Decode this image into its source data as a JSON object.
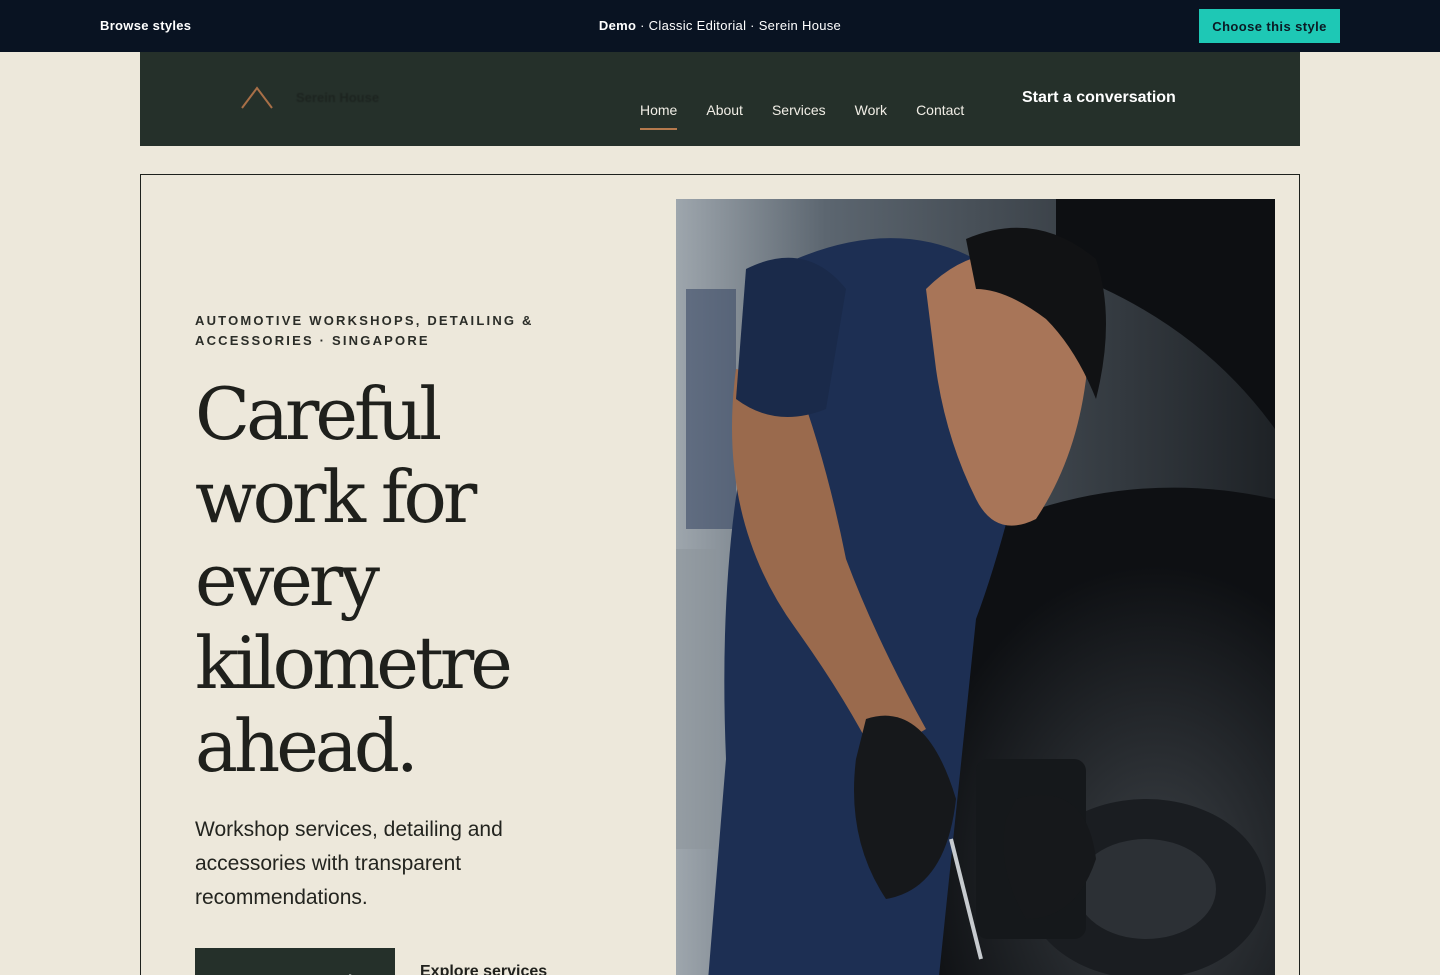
{
  "demo_bar": {
    "browse_label": "Browse styles",
    "demo_prefix": "Demo",
    "demo_rest": " · Classic Editorial · Serein House",
    "choose_label": "Choose this style"
  },
  "header": {
    "brand": "Serein House",
    "nav": [
      {
        "label": "Home",
        "active": true
      },
      {
        "label": "About"
      },
      {
        "label": "Services"
      },
      {
        "label": "Work"
      },
      {
        "label": "Contact"
      }
    ],
    "cta_label": "Start a conversation"
  },
  "hero": {
    "eyebrow": "Automotive workshops, detailing & accessories · Singapore",
    "headline_lines": [
      "Careful",
      "work for",
      "every",
      "kilometre",
      "ahead."
    ],
    "subhead": "Workshop services, detailing and accessories with transparent recommendations.",
    "primary_cta": "Start a conversation",
    "secondary_cta": "Explore services"
  },
  "colors": {
    "page_bg": "#ede8db",
    "demo_bar_bg": "#091322",
    "accent_teal": "#1ec8b5",
    "header_bg": "#25302a",
    "nav_underline": "#b5794d",
    "text_dark": "#1f201c"
  },
  "icons": {
    "logo": "chevron-up-icon"
  }
}
